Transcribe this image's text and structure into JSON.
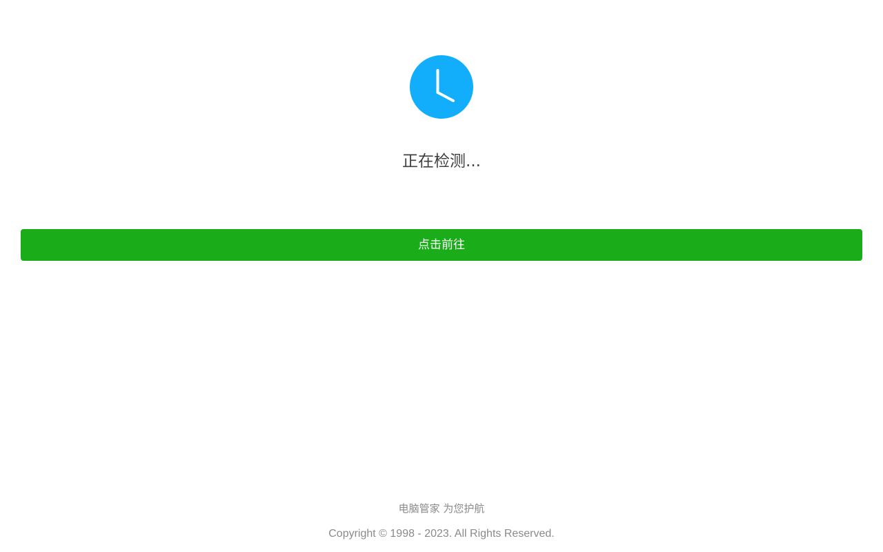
{
  "status": {
    "icon": "clock-icon",
    "text": "正在检测..."
  },
  "action": {
    "button_label": "点击前往"
  },
  "footer": {
    "slogan": "电脑管家 为您护航",
    "copyright": "Copyright © 1998 - 2023. All Rights Reserved."
  },
  "colors": {
    "icon_blue": "#12aefc",
    "button_green": "#1aad19",
    "text_dark": "#3f3f3f",
    "text_muted": "#8a8a8a"
  }
}
